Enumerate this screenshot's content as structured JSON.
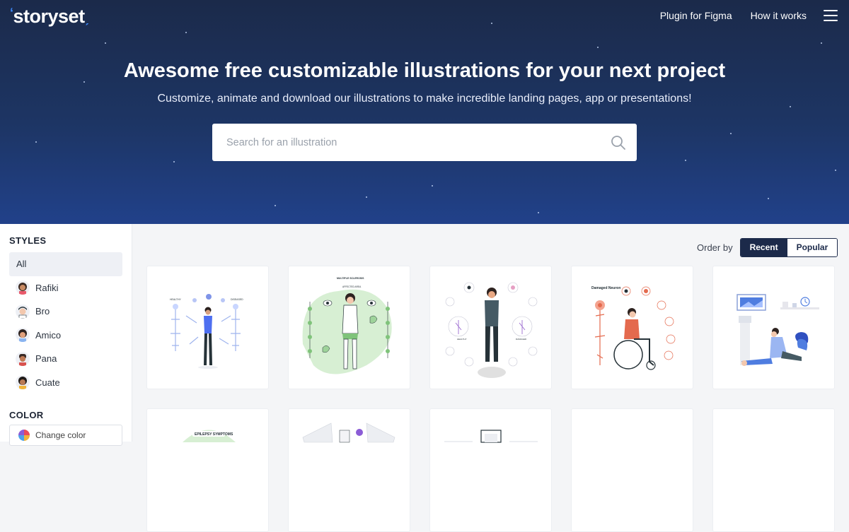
{
  "header": {
    "logo_text": "storyset",
    "nav": [
      {
        "label": "Plugin for Figma"
      },
      {
        "label": "How it works"
      }
    ]
  },
  "hero": {
    "title": "Awesome free customizable illustrations for your next project",
    "subtitle": "Customize, animate and download our illustrations to make incredible landing pages, app or presentations!",
    "search_placeholder": "Search for an illustration"
  },
  "sidebar": {
    "styles_title": "STYLES",
    "styles": [
      {
        "label": "All",
        "selected": true
      },
      {
        "label": "Rafiki"
      },
      {
        "label": "Bro"
      },
      {
        "label": "Amico"
      },
      {
        "label": "Pana"
      },
      {
        "label": "Cuate"
      }
    ],
    "color_title": "COLOR",
    "change_color_label": "Change color"
  },
  "order": {
    "label": "Order by",
    "options": [
      {
        "label": "Recent",
        "selected": true
      },
      {
        "label": "Popular",
        "selected": false
      }
    ]
  },
  "cards_row1": [
    {
      "illustration": "healthy-neuron-diseased-neuron"
    },
    {
      "illustration": "multiple-sclerosis"
    },
    {
      "illustration": "healthy-neuron-damaged-neuron"
    },
    {
      "illustration": "damaged-neuron-wheelchair",
      "caption": "Damaged Neuron"
    },
    {
      "illustration": "fainting-person"
    }
  ],
  "cards_row2": [
    {
      "illustration": "epilepsy-symptoms",
      "caption": "EPILEPSY SYMPTOMS"
    },
    {
      "illustration": "documents"
    },
    {
      "illustration": "frame"
    },
    {
      "illustration": "blank"
    },
    {
      "illustration": "blank"
    }
  ],
  "colors": {
    "hero_top": "#1b2a4a",
    "hero_bottom": "#21418a",
    "accent": "#3d8bff",
    "dark": "#1c2a4a"
  }
}
